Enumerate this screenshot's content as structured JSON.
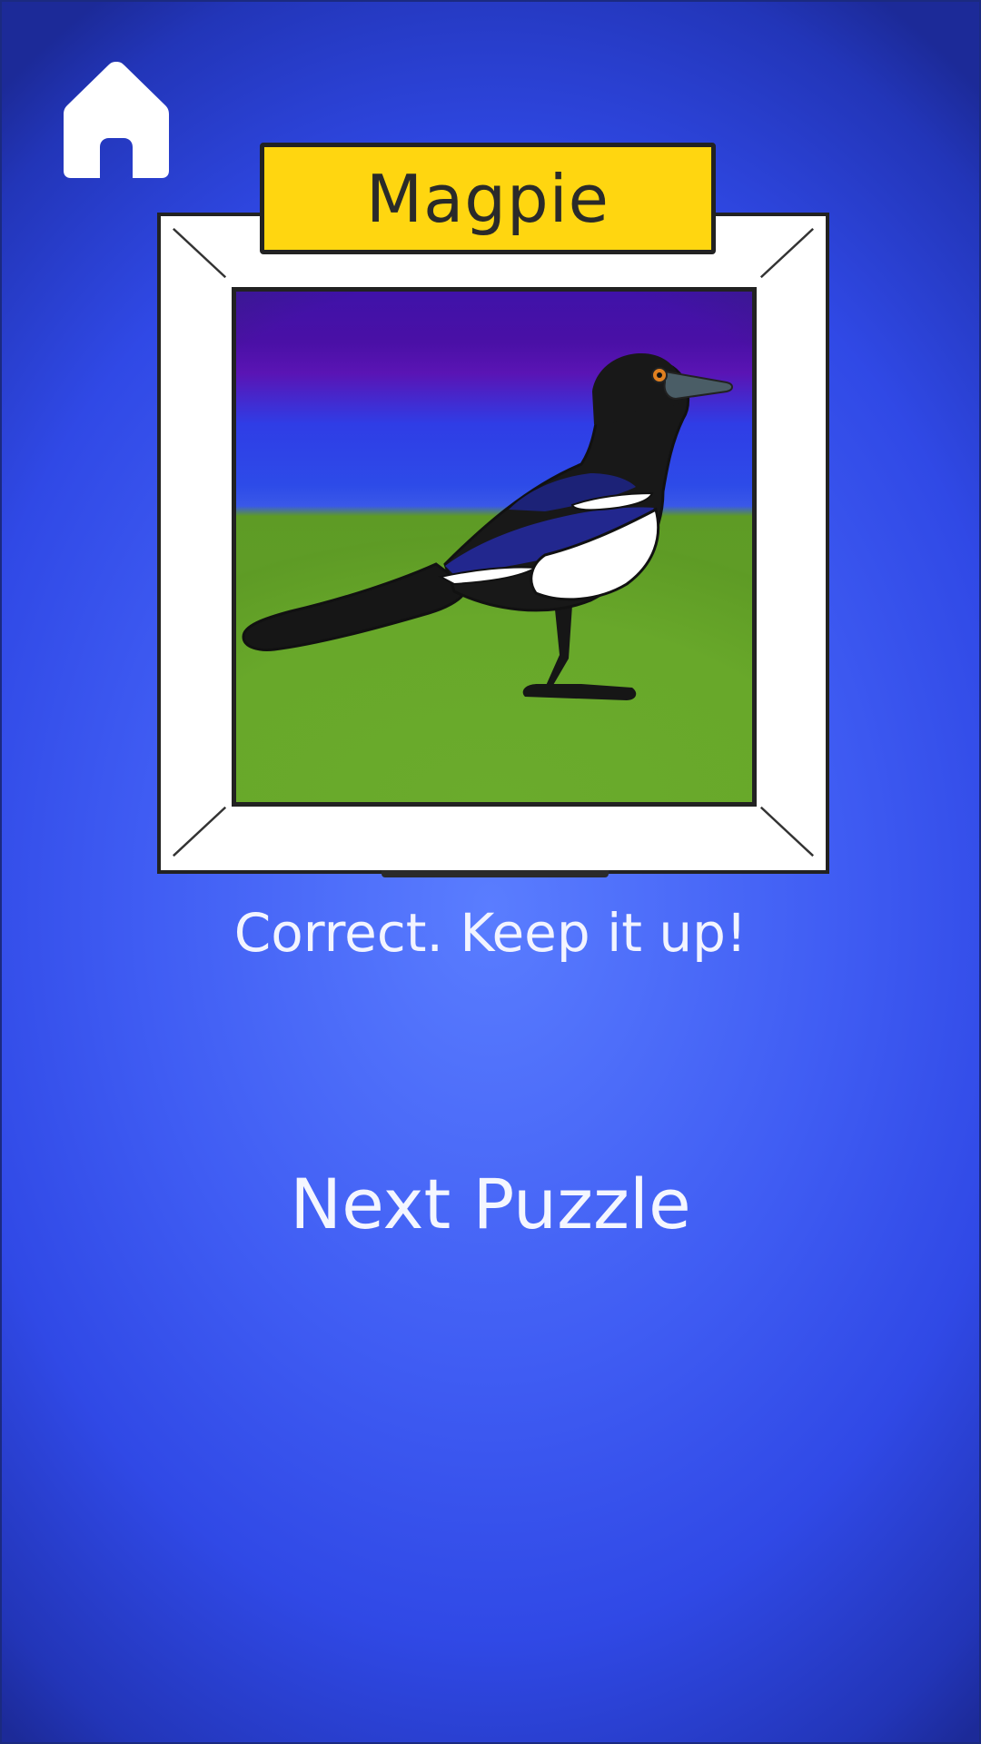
{
  "puzzle": {
    "bird_name": "Magpie",
    "feedback": "Correct. Keep it up!",
    "next_label": "Next Puzzle"
  },
  "icons": {
    "home": "home-icon"
  },
  "colors": {
    "background": "#3f5cf3",
    "title_plate": "#ffd610",
    "frame": "#ffffff",
    "text": "#f2f4ff"
  }
}
